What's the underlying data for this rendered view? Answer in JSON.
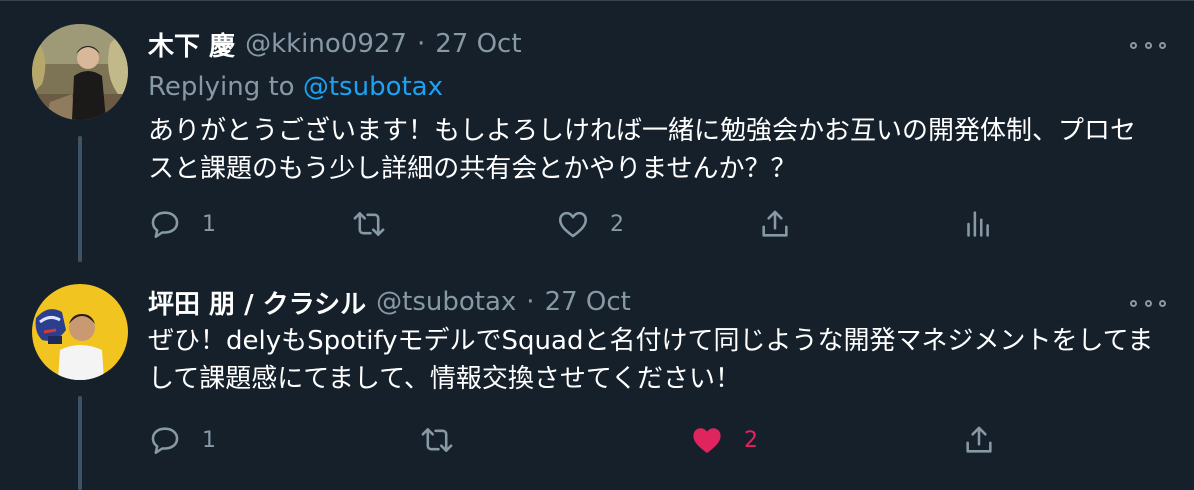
{
  "tweets": [
    {
      "name": "木下 慶",
      "handle": "@kkino0927",
      "separator": "·",
      "time": "27 Oct",
      "replying_prefix": "Replying to",
      "replying_handle": "@tsubotax",
      "body": "ありがとうございます！もしよろしければ一緒に勉強会かお互いの開発体制、プロセスと課題のもう少し詳細の共有会とかやりませんか？？",
      "reply_count": "1",
      "like_count": "2",
      "liked": false,
      "icons": [
        "reply-icon",
        "retweet-icon",
        "like-icon",
        "share-icon",
        "analytics-icon"
      ]
    },
    {
      "name": "坪田 朋 / クラシル",
      "handle": "@tsubotax",
      "separator": "·",
      "time": "27 Oct",
      "body": "ぜひ！delyもSpotifyモデルでSquadと名付けて同じような開発マネジメントをしてまして課題感にてまして、情報交換させてください！",
      "reply_count": "1",
      "like_count": "2",
      "liked": true,
      "icons": [
        "reply-icon",
        "retweet-icon",
        "like-icon",
        "share-icon"
      ]
    }
  ],
  "colors": {
    "background": "#15202b",
    "text": "#ffffff",
    "secondary": "#8899a6",
    "accent": "#1da1f2",
    "like": "#e0245e",
    "thread_line": "#3d5466"
  }
}
